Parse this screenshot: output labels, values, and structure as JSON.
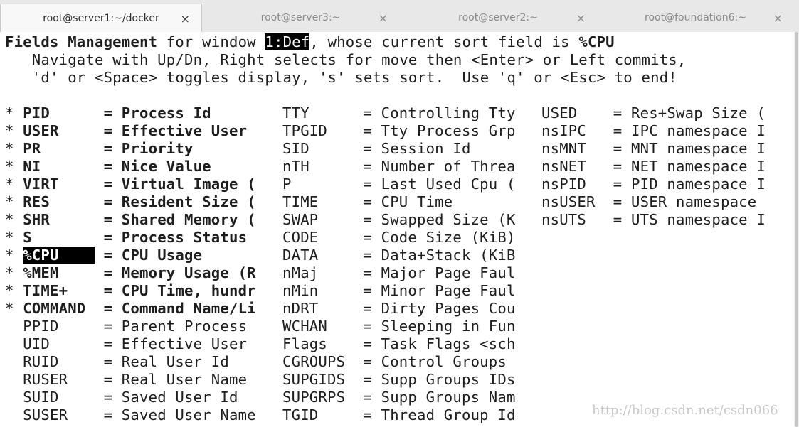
{
  "tabs": [
    {
      "title": "root@server1:~/docker",
      "close": "×",
      "active": true
    },
    {
      "title": "root@server3:~",
      "close": "×",
      "active": false
    },
    {
      "title": "root@server2:~",
      "close": "×",
      "active": false
    },
    {
      "title": "root@foundation6:~",
      "close": "×",
      "active": false
    }
  ],
  "header": {
    "fields_mgmt": "Fields Management",
    "for_window": " for window ",
    "window_name": "1:Def",
    "sort_text": ", whose current sort field is ",
    "sort_field": "%CPU",
    "help_line1": "   Navigate with Up/Dn, Right selects for move then <Enter> or Left commits,",
    "help_line2": "   'd' or <Space> toggles display, 's' sets sort.  Use 'q' or <Esc> to end!"
  },
  "fields": [
    {
      "mark": "*",
      "name": "PID",
      "desc": "Process Id",
      "shown": true
    },
    {
      "mark": "*",
      "name": "USER",
      "desc": "Effective User",
      "shown": true
    },
    {
      "mark": "*",
      "name": "PR",
      "desc": "Priority",
      "shown": true
    },
    {
      "mark": "*",
      "name": "NI",
      "desc": "Nice Value",
      "shown": true
    },
    {
      "mark": "*",
      "name": "VIRT",
      "desc": "Virtual Image (",
      "shown": true
    },
    {
      "mark": "*",
      "name": "RES",
      "desc": "Resident Size (",
      "shown": true
    },
    {
      "mark": "*",
      "name": "SHR",
      "desc": "Shared Memory (",
      "shown": true
    },
    {
      "mark": "*",
      "name": "S",
      "desc": "Process Status",
      "shown": true
    },
    {
      "mark": "*",
      "name": "%CPU",
      "desc": "CPU Usage",
      "shown": true,
      "selected": true
    },
    {
      "mark": "*",
      "name": "%MEM",
      "desc": "Memory Usage (R",
      "shown": true
    },
    {
      "mark": "*",
      "name": "TIME+",
      "desc": "CPU Time, hundr",
      "shown": true
    },
    {
      "mark": "*",
      "name": "COMMAND",
      "desc": "Command Name/Li",
      "shown": true
    },
    {
      "mark": "",
      "name": "PPID",
      "desc": "Parent Process",
      "shown": false
    },
    {
      "mark": "",
      "name": "UID",
      "desc": "Effective User",
      "shown": false
    },
    {
      "mark": "",
      "name": "RUID",
      "desc": "Real User Id",
      "shown": false
    },
    {
      "mark": "",
      "name": "RUSER",
      "desc": "Real User Name",
      "shown": false
    },
    {
      "mark": "",
      "name": "SUID",
      "desc": "Saved User Id",
      "shown": false
    },
    {
      "mark": "",
      "name": "SUSER",
      "desc": "Saved User Name",
      "shown": false
    },
    {
      "name": "TTY",
      "desc": "Controlling Tty",
      "col": 2
    },
    {
      "name": "TPGID",
      "desc": "Tty Process Grp",
      "col": 2
    },
    {
      "name": "SID",
      "desc": "Session Id",
      "col": 2
    },
    {
      "name": "nTH",
      "desc": "Number of Threa",
      "col": 2
    },
    {
      "name": "P",
      "desc": "Last Used Cpu (",
      "col": 2
    },
    {
      "name": "TIME",
      "desc": "CPU Time",
      "col": 2
    },
    {
      "name": "SWAP",
      "desc": "Swapped Size (K",
      "col": 2
    },
    {
      "name": "CODE",
      "desc": "Code Size (KiB)",
      "col": 2
    },
    {
      "name": "DATA",
      "desc": "Data+Stack (KiB",
      "col": 2
    },
    {
      "name": "nMaj",
      "desc": "Major Page Faul",
      "col": 2
    },
    {
      "name": "nMin",
      "desc": "Minor Page Faul",
      "col": 2
    },
    {
      "name": "nDRT",
      "desc": "Dirty Pages Cou",
      "col": 2
    },
    {
      "name": "WCHAN",
      "desc": "Sleeping in Fun",
      "col": 2
    },
    {
      "name": "Flags",
      "desc": "Task Flags <sch",
      "col": 2
    },
    {
      "name": "CGROUPS",
      "desc": "Control Groups",
      "col": 2
    },
    {
      "name": "SUPGIDS",
      "desc": "Supp Groups IDs",
      "col": 2
    },
    {
      "name": "SUPGRPS",
      "desc": "Supp Groups Nam",
      "col": 2
    },
    {
      "name": "TGID",
      "desc": "Thread Group Id",
      "col": 2
    },
    {
      "name": "USED",
      "desc": "Res+Swap Size (",
      "col": 3
    },
    {
      "name": "nsIPC",
      "desc": "IPC namespace I",
      "col": 3
    },
    {
      "name": "nsMNT",
      "desc": "MNT namespace I",
      "col": 3
    },
    {
      "name": "nsNET",
      "desc": "NET namespace I",
      "col": 3
    },
    {
      "name": "nsPID",
      "desc": "PID namespace I",
      "col": 3
    },
    {
      "name": "nsUSER",
      "desc": "USER namespace",
      "col": 3
    },
    {
      "name": "nsUTS",
      "desc": "UTS namespace I",
      "col": 3
    }
  ],
  "equals": "=",
  "watermark": "http://blog.csdn.net/csdn066"
}
